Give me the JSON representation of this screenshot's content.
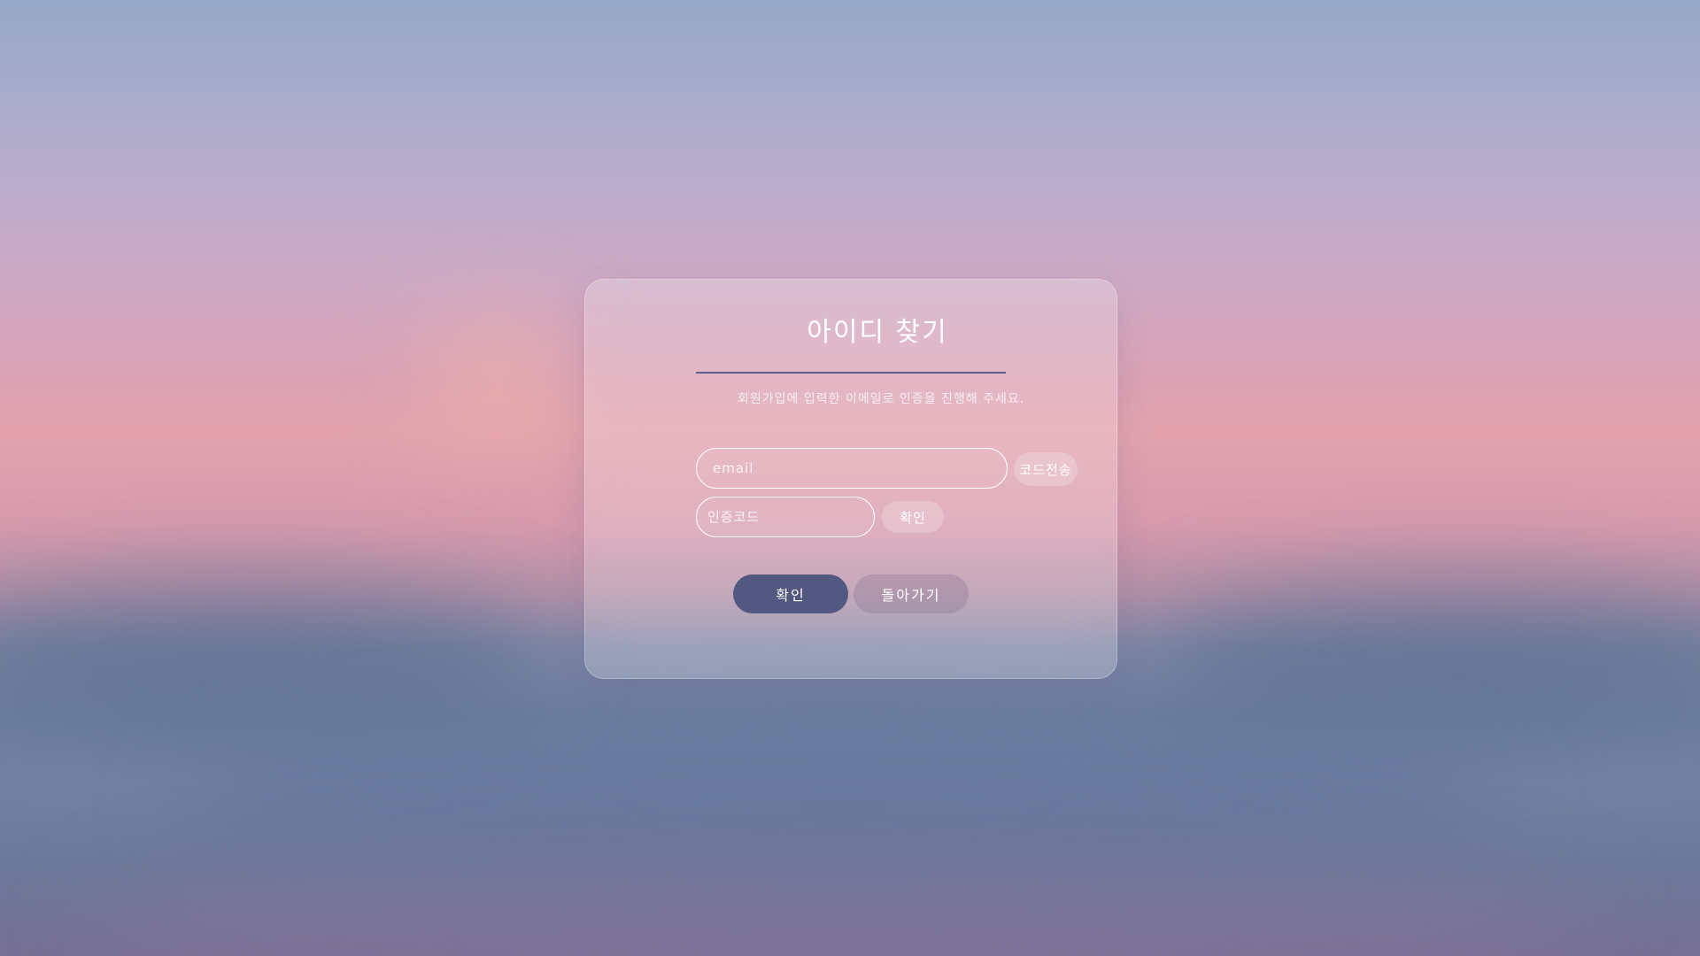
{
  "page": {
    "title": "아이디 찾기",
    "description": "회원가입에 입력한 이메일로 인증을 진행해 주세요."
  },
  "form": {
    "email_placeholder": "email",
    "send_code_label": "코드전송",
    "code_placeholder": "인증코드",
    "verify_label": "확인"
  },
  "actions": {
    "confirm_label": "확인",
    "back_label": "돌아가기"
  },
  "colors": {
    "accent": "#535880",
    "underline": "#5a5f8c",
    "text": "#ffffff"
  }
}
